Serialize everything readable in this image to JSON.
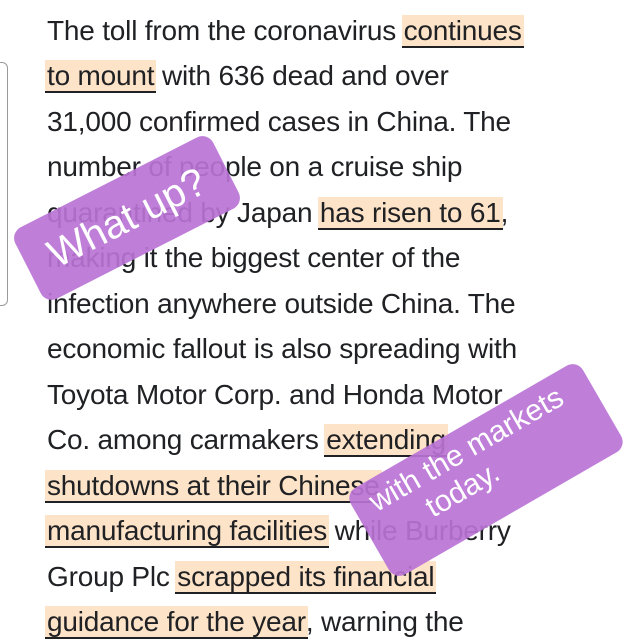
{
  "article": {
    "lines": [
      {
        "segments": [
          {
            "text": "The toll from the coronavirus "
          },
          {
            "text": "continues",
            "hl": true
          }
        ]
      },
      {
        "segments": [
          {
            "text": "to mount",
            "hl": true
          },
          {
            "text": " with 636 dead and over"
          }
        ]
      },
      {
        "segments": [
          {
            "text": "31,000 confirmed cases in China. The"
          }
        ]
      },
      {
        "segments": [
          {
            "text": "number of people on a cruise ship"
          }
        ]
      },
      {
        "segments": [
          {
            "text": "quarantined by Japan "
          },
          {
            "text": "has risen to 61",
            "hl": true
          },
          {
            "text": ","
          }
        ]
      },
      {
        "segments": [
          {
            "text": "making it the biggest center of the"
          }
        ]
      },
      {
        "segments": [
          {
            "text": "infection anywhere outside China. The"
          }
        ]
      },
      {
        "segments": [
          {
            "text": "economic fallout is also spreading with"
          }
        ]
      },
      {
        "segments": [
          {
            "text": "Toyota Motor Corp. and Honda Motor"
          }
        ]
      },
      {
        "segments": [
          {
            "text": "Co. among carmakers "
          },
          {
            "text": "extending",
            "hl": true
          }
        ]
      },
      {
        "segments": [
          {
            "text": "shutdowns at their Chinese",
            "hl": true
          }
        ]
      },
      {
        "segments": [
          {
            "text": "manufacturing facilities",
            "hl": true
          },
          {
            "text": " while Burberry"
          }
        ]
      },
      {
        "segments": [
          {
            "text": "Group Plc "
          },
          {
            "text": "scrapped its financial",
            "hl": true
          }
        ]
      },
      {
        "segments": [
          {
            "text": "guidance for the year",
            "hl": true
          },
          {
            "text": ", warning the"
          }
        ]
      }
    ]
  },
  "stickers": {
    "sticker1": "What up?",
    "sticker2_line1": "with the markets",
    "sticker2_line2": "today."
  },
  "colors": {
    "highlight": "#fde3c7",
    "sticker": "#ba74d6",
    "text": "#202124"
  }
}
